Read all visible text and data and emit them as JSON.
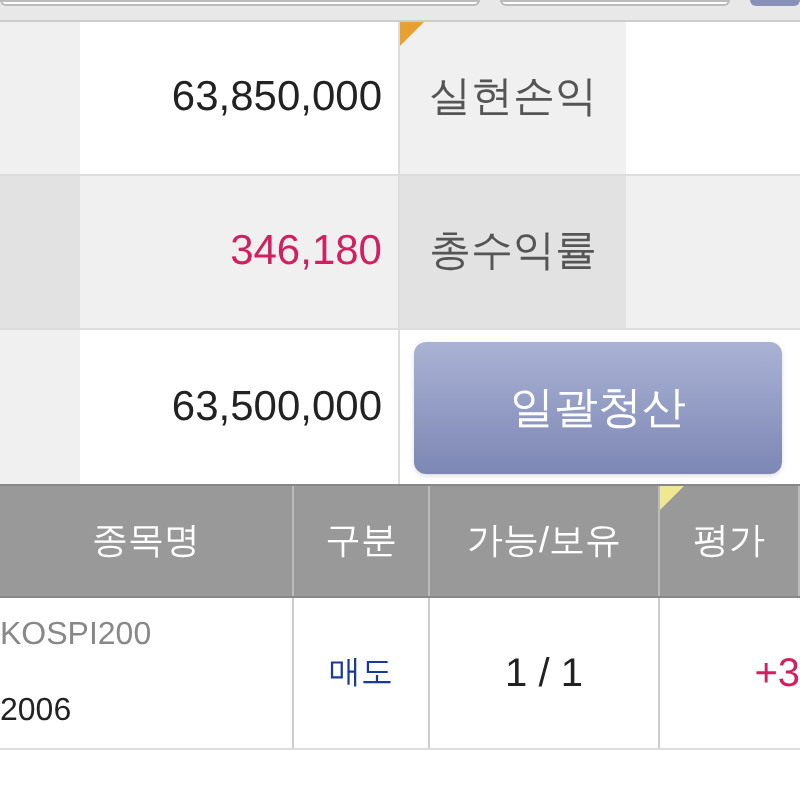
{
  "summary": [
    {
      "value": "63,850,000",
      "color": "#222222",
      "side_label": "실현손익",
      "flag": true
    },
    {
      "value": "346,180",
      "color": "#d02060",
      "side_label": "총수익률",
      "flag": false
    }
  ],
  "last_row": {
    "value": "63,500,000",
    "button": "일괄청산"
  },
  "table": {
    "columns": [
      {
        "label": "종목명",
        "flag": false
      },
      {
        "label": "구분",
        "flag": false
      },
      {
        "label": "가능/보유",
        "flag": false
      },
      {
        "label": "평가",
        "flag": true
      }
    ],
    "rows": [
      {
        "name": "KOSPI200",
        "code": "2006",
        "side": "매도",
        "qty": "1 / 1",
        "eval": "+3"
      }
    ]
  }
}
